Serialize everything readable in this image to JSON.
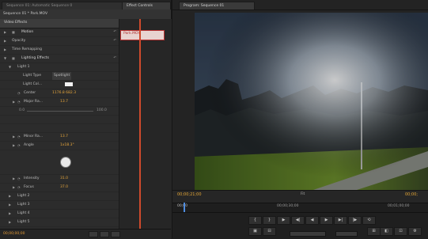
{
  "left_panel": {
    "tabs": [
      {
        "label": "Sequence 01: Automatic Sequence 0"
      },
      {
        "label": "Effect Controls"
      }
    ],
    "sequence_label": "Sequence 01 * Park.MOV",
    "clip_name": "Park.MOV",
    "video_effects_label": "Video Effects",
    "rows": [
      {
        "label": "Motion"
      },
      {
        "label": "Opacity"
      },
      {
        "label": "Time Remapping"
      },
      {
        "label": "Lighting Effects"
      },
      {
        "label": "Light 1"
      },
      {
        "label": "Light Type",
        "value": "Spotlight"
      },
      {
        "label": "Light Col...",
        "value": ""
      },
      {
        "label": "Center",
        "value": "1176.8  682.3"
      },
      {
        "label": "Major Ra...",
        "value": "13.7"
      },
      {
        "label": "",
        "value": ""
      },
      {
        "label": "",
        "value": ""
      },
      {
        "label": "Minor Ra...",
        "value": "13.7"
      },
      {
        "label": "Angle",
        "value": "1x18.3°"
      },
      {
        "label": "",
        "value": ""
      },
      {
        "label": "Intensity",
        "value": "31.0"
      },
      {
        "label": "Focus",
        "value": "37.0"
      },
      {
        "label": "Light 2"
      },
      {
        "label": "Light 3"
      },
      {
        "label": "Light 4"
      },
      {
        "label": "Light 5"
      }
    ],
    "scale_left": "0.0",
    "scale_right": "100.0",
    "bottom_timecode": "00;00;00;00"
  },
  "program_monitor": {
    "tab_label": "Program: Sequence 01",
    "current_timecode": "00;00;21;00",
    "duration_timecode": "00;00;",
    "fit_label": "Fit",
    "ruler_label": "00;00",
    "ruler_mid": "00;00;30;00",
    "ruler_end": "00;01;00;00"
  },
  "controls": {
    "row1": [
      "{",
      "}",
      "▶",
      "◀|",
      "▶|",
      "◀",
      "▶",
      "|▶",
      "⟲"
    ],
    "row2": [
      "▣",
      "⊟",
      "⊞",
      "◧",
      "⊡",
      "⚙"
    ]
  },
  "colors": {
    "accent_timecode": "#e3a535",
    "playhead": "#cf4a2c"
  }
}
